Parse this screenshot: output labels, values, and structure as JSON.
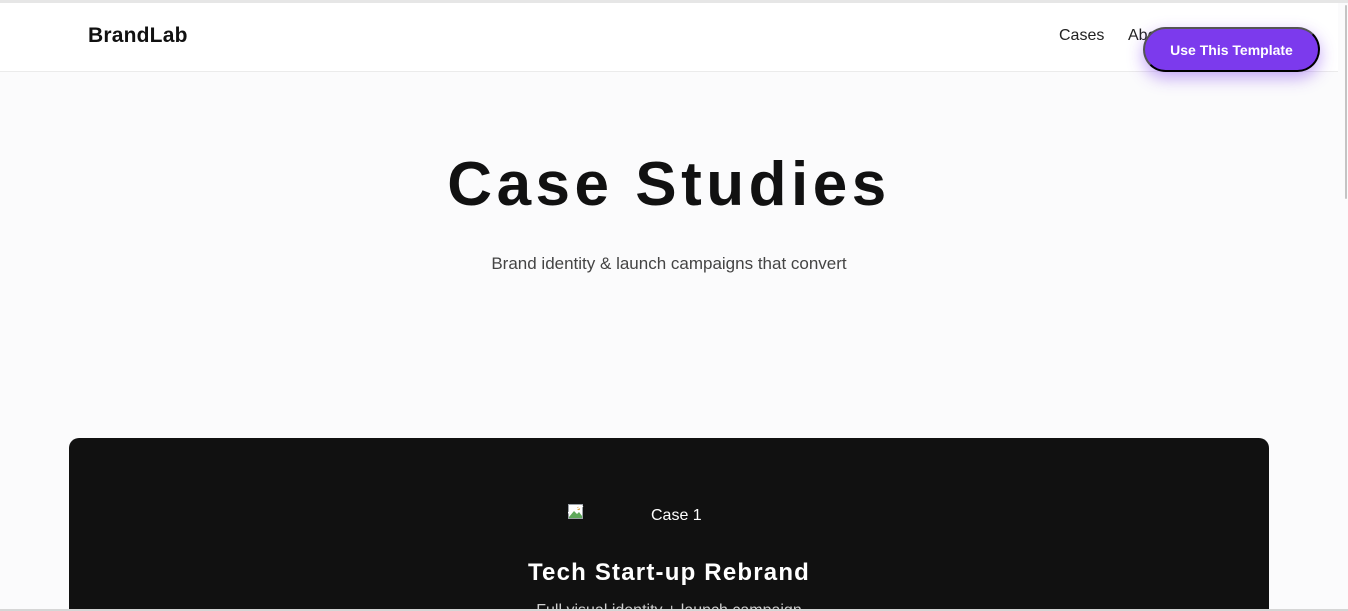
{
  "header": {
    "logo": "BrandLab",
    "nav": {
      "cases": "Cases",
      "about": "About"
    },
    "cta_label": "Use This Template"
  },
  "hero": {
    "title": "Case Studies",
    "subtitle": "Brand identity & launch campaigns that convert"
  },
  "cases": [
    {
      "image_alt": "Case 1",
      "title": "Tech Start-up Rebrand",
      "description": "Full visual identity + launch campaign"
    }
  ],
  "colors": {
    "accent": "#7c3aed",
    "card_background": "#111111",
    "page_background": "#fbfbfc"
  },
  "icons": {
    "case_image": "broken-image-icon"
  }
}
